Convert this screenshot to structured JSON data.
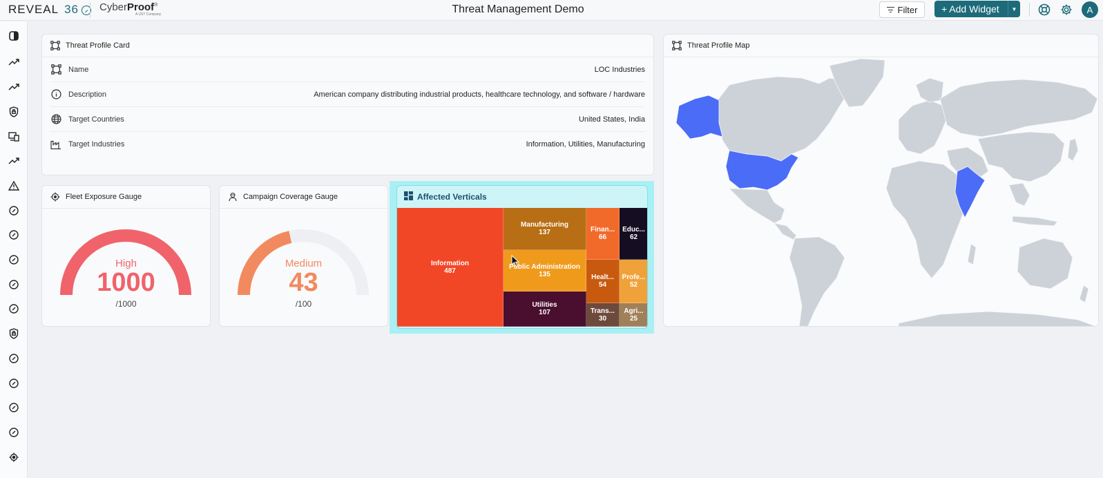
{
  "header": {
    "brand": "REVEAL",
    "brand_num": "36",
    "partner_light": "Cyber",
    "partner_bold": "Proof",
    "partner_mark": "®",
    "partner_sub": "A UST Company",
    "title": "Threat Management Demo",
    "filter_label": "Filter",
    "add_widget_label": "+ Add Widget",
    "avatar_initial": "A"
  },
  "profile_card": {
    "title": "Threat Profile Card",
    "rows": [
      {
        "key": "Name",
        "value": "LOC Industries",
        "icon": "frame-icon"
      },
      {
        "key": "Description",
        "value": "American company distributing industrial products, healthcare technology, and software / hardware",
        "icon": "info-icon"
      },
      {
        "key": "Target Countries",
        "value": "United States, India",
        "icon": "globe-icon"
      },
      {
        "key": "Target Industries",
        "value": "Information, Utilities, Manufacturing",
        "icon": "factory-icon"
      }
    ]
  },
  "fleet_gauge": {
    "title": "Fleet Exposure Gauge",
    "level": "High",
    "value": "1000",
    "max": "/1000",
    "fraction": 1.0,
    "color": "#f0636b"
  },
  "campaign_gauge": {
    "title": "Campaign Coverage Gauge",
    "level": "Medium",
    "value": "43",
    "max": "/100",
    "fraction": 0.43,
    "color": "#f28a5f"
  },
  "treemap": {
    "title": "Affected Verticals",
    "cells": [
      {
        "label": "Information",
        "value": "487",
        "color": "#f24726"
      },
      {
        "label": "Manufacturing",
        "value": "137",
        "color": "#b86e14"
      },
      {
        "label": "Public Administration",
        "value": "135",
        "color": "#f09a1c"
      },
      {
        "label": "Utilities",
        "value": "107",
        "color": "#4a0e2e"
      },
      {
        "label": "Finan...",
        "value": "66",
        "color": "#f26a2a"
      },
      {
        "label": "Educ...",
        "value": "62",
        "color": "#150d22"
      },
      {
        "label": "Healt...",
        "value": "54",
        "color": "#c85a0f"
      },
      {
        "label": "Profe...",
        "value": "52",
        "color": "#f0a23a"
      },
      {
        "label": "Trans...",
        "value": "30",
        "color": "#6e4a3c"
      },
      {
        "label": "Agri...",
        "value": "25",
        "color": "#a0805a"
      }
    ]
  },
  "map_card": {
    "title": "Threat Profile Map",
    "highlight_color": "#4a6cf7",
    "land_color": "#cdd2d9"
  }
}
